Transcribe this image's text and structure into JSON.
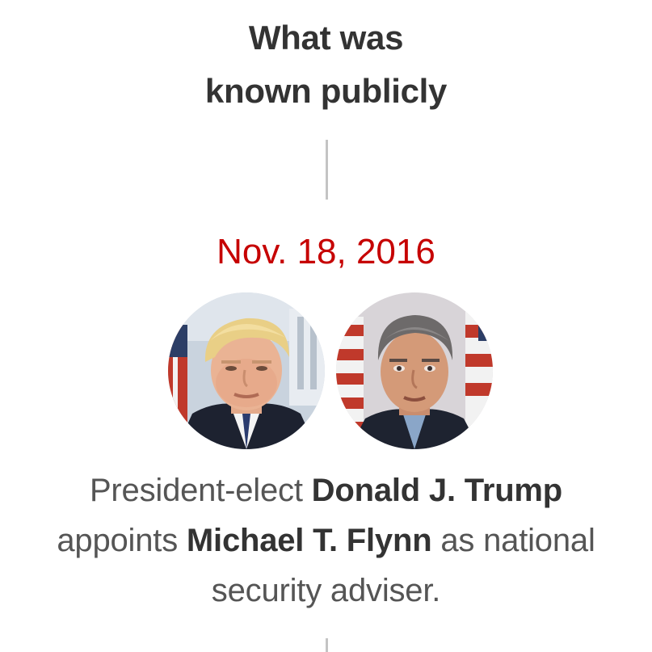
{
  "heading": {
    "line1": "What was",
    "line2": "known publicly"
  },
  "event": {
    "date": "Nov. 18, 2016",
    "portraits": [
      {
        "icon": "portrait-trump-photo"
      },
      {
        "icon": "portrait-flynn-photo"
      }
    ],
    "caption": {
      "part1": "President-elect ",
      "name1": "Donald J. Trump",
      "part2": " appoints ",
      "name2": "Michael T. Flynn",
      "part3": " as national security adviser."
    }
  },
  "colors": {
    "date": "#c60000",
    "heading": "#333333",
    "body_text": "#555555",
    "connector": "#c4c4c4"
  }
}
